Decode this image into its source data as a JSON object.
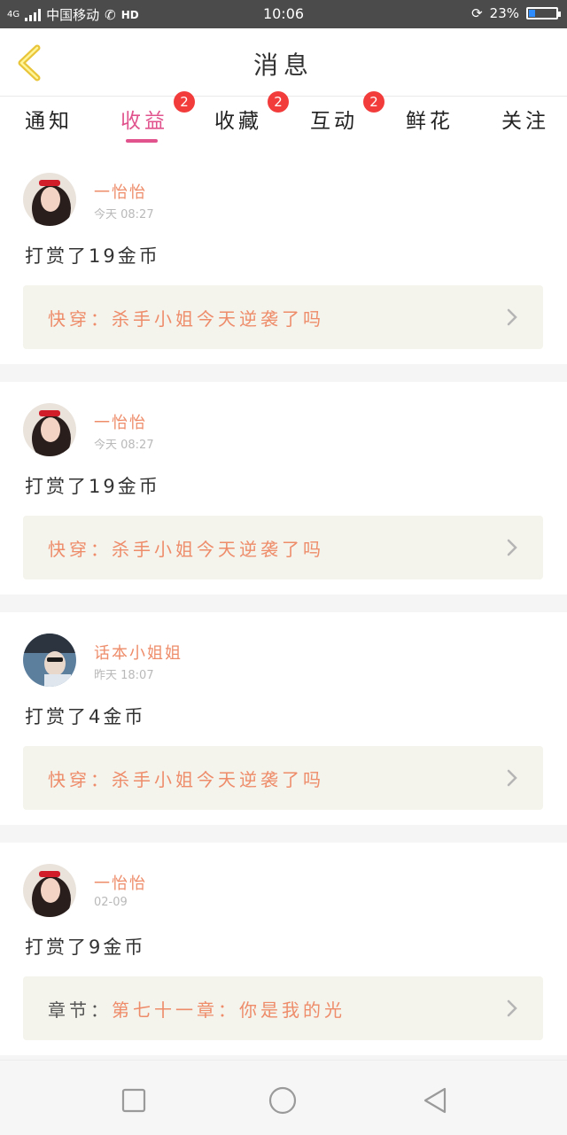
{
  "status_bar": {
    "network": "4G",
    "carrier": "中国移动",
    "hd": "HD",
    "time": "10:06",
    "battery": "23%",
    "battery_level": 0.23
  },
  "header": {
    "title": "消息"
  },
  "tabs": [
    {
      "label": "通知",
      "badge": ""
    },
    {
      "label": "收益",
      "badge": "2",
      "active": true
    },
    {
      "label": "收藏",
      "badge": "2"
    },
    {
      "label": "互动",
      "badge": "2"
    },
    {
      "label": "鲜花",
      "badge": ""
    },
    {
      "label": "关注",
      "badge": ""
    }
  ],
  "messages": [
    {
      "name": "一怡怡",
      "time": "今天 08:27",
      "text": "打赏了19金币",
      "link_prefix": "快穿：",
      "link_text": "杀手小姐今天逆袭了吗",
      "avatar": "girl-red-bow"
    },
    {
      "name": "一怡怡",
      "time": "今天 08:27",
      "text": "打赏了19金币",
      "link_prefix": "快穿：",
      "link_text": "杀手小姐今天逆袭了吗",
      "avatar": "girl-red-bow"
    },
    {
      "name": "话本小姐姐",
      "time": "昨天 18:07",
      "text": "打赏了4金币",
      "link_prefix": "快穿：",
      "link_text": "杀手小姐今天逆袭了吗",
      "avatar": "man-car"
    },
    {
      "name": "一怡怡",
      "time": "02-09",
      "text": "打赏了9金币",
      "link_prefix": "章节：",
      "link_text": "第七十一章：你是我的光",
      "avatar": "girl-red-bow"
    }
  ],
  "colors": {
    "accent": "#e0538d",
    "badge": "#f23b3b",
    "name": "#ee8c6a",
    "link_bg": "#f4f3ec",
    "back_icon": "#e9c53a"
  },
  "nav": {
    "icons": [
      "square-icon",
      "circle-icon",
      "triangle-back-icon"
    ]
  }
}
